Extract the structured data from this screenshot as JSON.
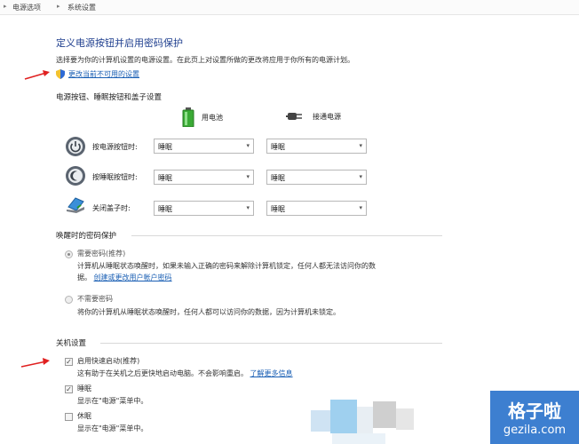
{
  "breadcrumb": [
    "电源选项",
    "系统设置"
  ],
  "title": "定义电源按钮并启用密码保护",
  "description": "选择要为你的计算机设置的电源设置。在此页上对设置所做的更改将应用于你所有的电源计划。",
  "change_link": "更改当前不可用的设置",
  "section_buttons": {
    "heading": "电源按钮、睡眠按钮和盖子设置",
    "col_battery": "用电池",
    "col_ac": "接通电源",
    "rows": [
      {
        "label": "按电源按钮时:",
        "battery": "睡眠",
        "ac": "睡眠"
      },
      {
        "label": "按睡眠按钮时:",
        "battery": "睡眠",
        "ac": "睡眠"
      },
      {
        "label": "关闭盖子时:",
        "battery": "睡眠",
        "ac": "睡眠"
      }
    ]
  },
  "section_password": {
    "heading": "唤醒时的密码保护",
    "require_label": "需要密码(推荐)",
    "require_text_1": "计算机从睡眠状态唤醒时，如果未输入正确的密码来解除计算机锁定，任何人都无法访问你的数",
    "require_text_2": "据。",
    "require_link": "创建或更改用户帐户密码",
    "norequire_label": "不需要密码",
    "norequire_text": "将你的计算机从睡眠状态唤醒时，任何人都可以访问你的数据，因为计算机未锁定。"
  },
  "section_shutdown": {
    "heading": "关机设置",
    "fast_label": "启用快速启动(推荐)",
    "fast_text": "这有助于在关机之后更快地启动电脑。不会影响重启。",
    "fast_link": "了解更多信息",
    "sleep_label": "睡眠",
    "sleep_text": "显示在\"电源\"菜单中。",
    "hibernate_label": "休眠",
    "hibernate_text": "显示在\"电源\"菜单中。"
  },
  "watermark": {
    "cn": "格子啦",
    "en": "gezila.com"
  },
  "colors": {
    "link": "#1a5fb4",
    "title": "#1f3f8f",
    "arrow": "#e02020",
    "watermark": "#3d7fd0"
  }
}
